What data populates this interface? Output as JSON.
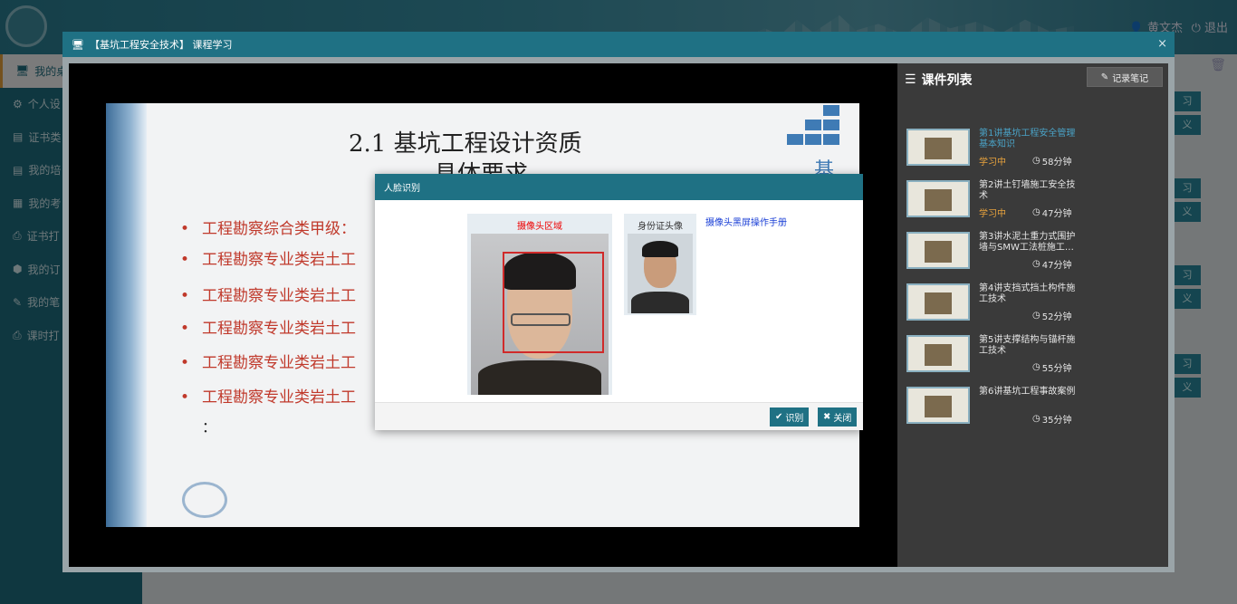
{
  "header": {
    "user_name": "黄文杰",
    "logout_label": "退出"
  },
  "sidebar": {
    "items": [
      {
        "icon": "monitor-icon",
        "label": "我的桌"
      },
      {
        "icon": "gear-icon",
        "label": "个人设"
      },
      {
        "icon": "certificate-icon",
        "label": "证书类"
      },
      {
        "icon": "training-icon",
        "label": "我的培"
      },
      {
        "icon": "calculator-icon",
        "label": "我的考"
      },
      {
        "icon": "print-icon",
        "label": "证书打"
      },
      {
        "icon": "order-icon",
        "label": "我的订"
      },
      {
        "icon": "edit-icon",
        "label": "我的笔"
      },
      {
        "icon": "print-icon",
        "label": "课时打"
      }
    ]
  },
  "side_buttons": [
    "习",
    "义",
    "习",
    "义",
    "习",
    "义",
    "习",
    "义"
  ],
  "course_window": {
    "title": "【基坑工程安全技术】 课程学习",
    "close_glyph": "×"
  },
  "slide": {
    "title_line1": "2.1 基坑工程设计资质",
    "title_line2": "—具体要求",
    "corner_char": "基",
    "bullets": [
      "工程勘察综合类甲级：",
      "工程勘察专业类岩土工",
      "工程勘察专业类岩土工",
      "工程勘察专业类岩土工",
      "工程勘察专业类岩土工",
      "工程勘察专业类岩土工"
    ],
    "colon": "："
  },
  "course_list": {
    "title": "课件列表",
    "note_button": "记录笔记",
    "lessons": [
      {
        "title": "第1讲基坑工程安全管理基本知识",
        "status": "学习中",
        "duration": "58分钟",
        "current": true
      },
      {
        "title": "第2讲土钉墙施工安全技术",
        "status": "学习中",
        "duration": "47分钟",
        "current": false
      },
      {
        "title": "第3讲水泥土重力式围护墙与SMW工法桩施工…",
        "status": "",
        "duration": "47分钟",
        "current": false
      },
      {
        "title": "第4讲支挡式挡土构件施工技术",
        "status": "",
        "duration": "52分钟",
        "current": false
      },
      {
        "title": "第5讲支撑结构与锚杆施工技术",
        "status": "",
        "duration": "55分钟",
        "current": false
      },
      {
        "title": "第6讲基坑工程事故案例",
        "status": "",
        "duration": "35分钟",
        "current": false
      }
    ]
  },
  "face_dialog": {
    "title": "人脸识别",
    "camera_label": "摄像头区域",
    "id_label": "身份证头像",
    "manual_link": "摄像头黑屏操作手册",
    "recognize_button": "识别",
    "close_button": "关闭"
  }
}
